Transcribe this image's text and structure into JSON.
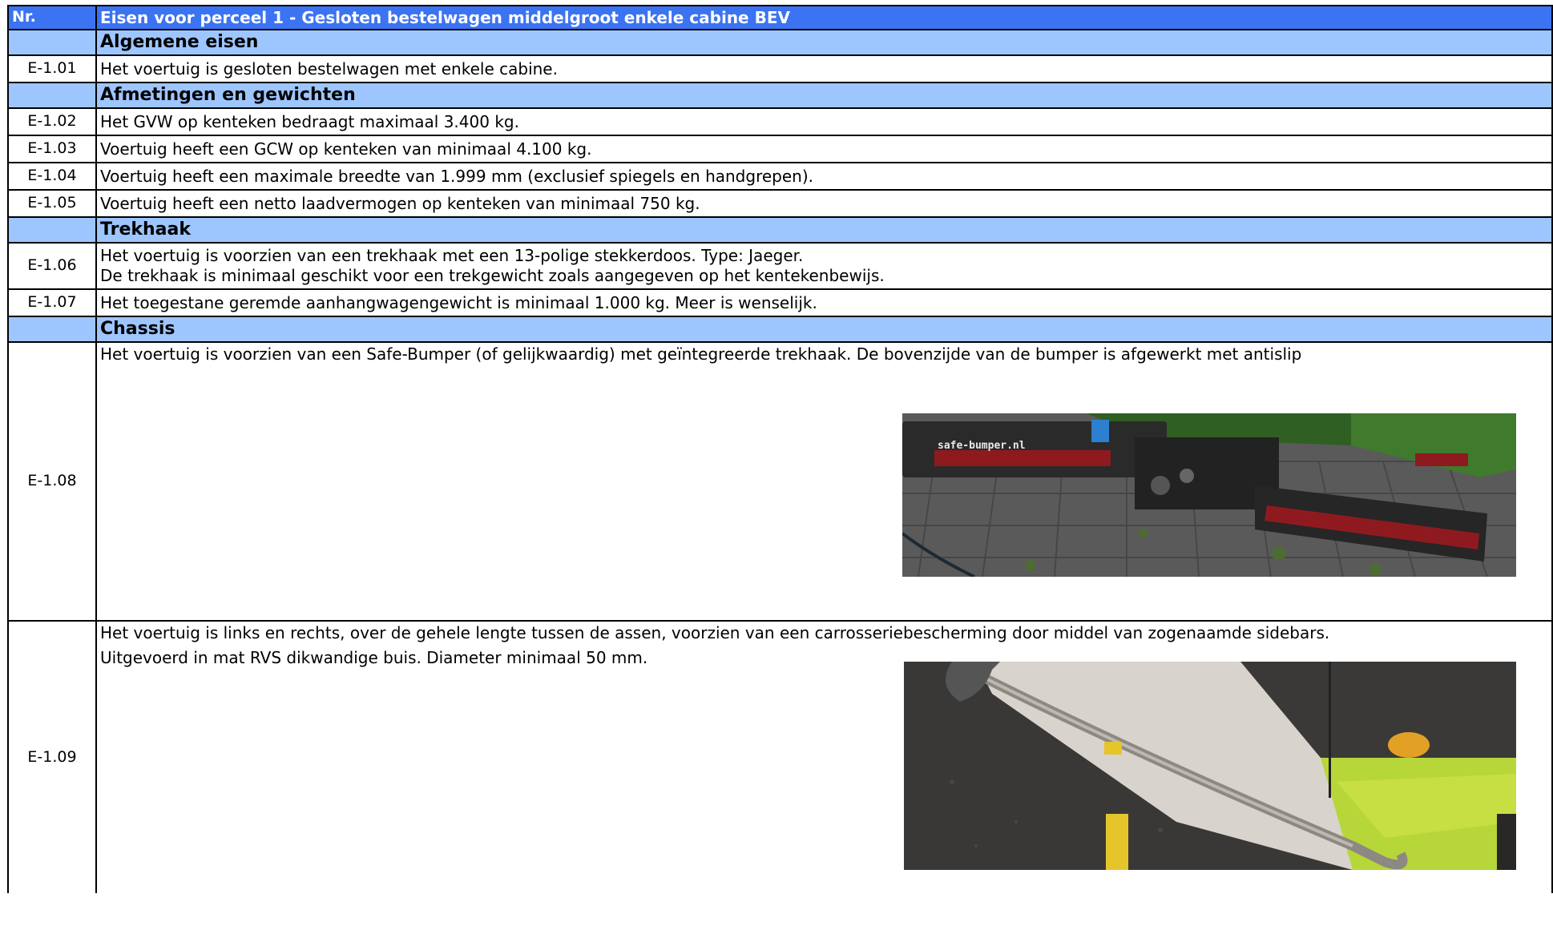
{
  "header": {
    "nr_label": "Nr.",
    "title": "Eisen voor perceel 1 - Gesloten bestelwagen middelgroot enkele cabine BEV"
  },
  "sections": {
    "algemeen": "Algemene eisen",
    "afmetingen": "Afmetingen en gewichten",
    "trekhaak": "Trekhaak",
    "chassis": "Chassis"
  },
  "rows": {
    "e101": {
      "nr": "E-1.01",
      "text": "Het voertuig is gesloten bestelwagen met enkele cabine."
    },
    "e102": {
      "nr": "E-1.02",
      "text": "Het GVW op kenteken bedraagt maximaal 3.400 kg."
    },
    "e103": {
      "nr": "E-1.03",
      "text": "Voertuig heeft een GCW op kenteken van minimaal 4.100 kg."
    },
    "e104": {
      "nr": "E-1.04",
      "text": "Voertuig heeft een maximale breedte van 1.999 mm (exclusief spiegels en handgrepen)."
    },
    "e105": {
      "nr": "E-1.05",
      "text": "Voertuig heeft een netto laadvermogen op kenteken van minimaal 750 kg."
    },
    "e106": {
      "nr": "E-1.06",
      "line1": "Het voertuig is voorzien van een trekhaak met een 13-polige stekkerdoos. Type: Jaeger.",
      "line2": "De trekhaak is minimaal geschikt voor een trekgewicht zoals aangegeven op het kentekenbewijs."
    },
    "e107": {
      "nr": "E-1.07",
      "text": "Het toegestane geremde aanhangwagengewicht is minimaal 1.000 kg. Meer is wenselijk."
    },
    "e108": {
      "nr": "E-1.08",
      "text": "Het voertuig is voorzien van een Safe-Bumper (of gelijkwaardig) met geïntegreerde trekhaak. De bovenzijde van de bumper is afgewerkt met antislip",
      "photo_caption": "safe-bumper.nl"
    },
    "e109": {
      "nr": "E-1.09",
      "line1": "Het voertuig is links en rechts, over de gehele lengte tussen de assen, voorzien van een carrosseriebescherming door middel van zogenaamde sidebars.",
      "line2": "Uitgevoerd in mat RVS dikwandige buis. Diameter minimaal 50 mm."
    }
  },
  "colors": {
    "header": "#3b73f2",
    "section": "#9dc6ff"
  }
}
